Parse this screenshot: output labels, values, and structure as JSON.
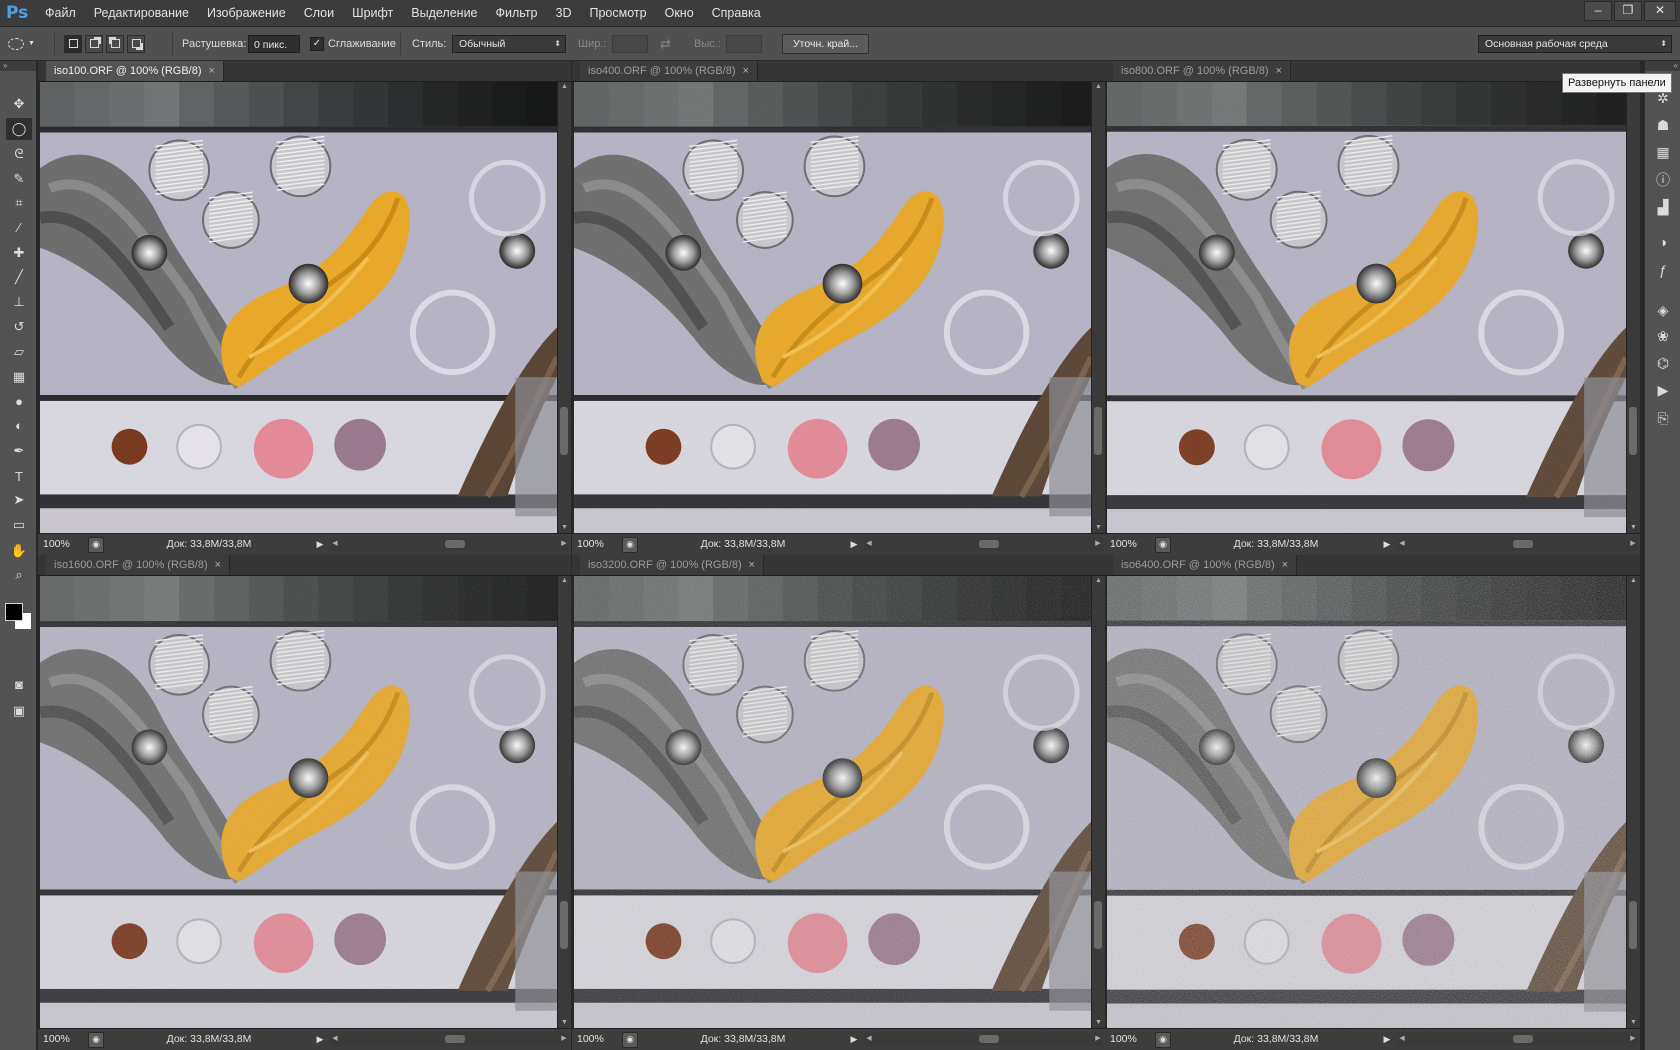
{
  "app": {
    "logo": "Ps"
  },
  "menu": [
    "Файл",
    "Редактирование",
    "Изображение",
    "Слои",
    "Шрифт",
    "Выделение",
    "Фильтр",
    "3D",
    "Просмотр",
    "Окно",
    "Справка"
  ],
  "window_controls": {
    "minimize": "–",
    "restore": "❐",
    "close": "✕"
  },
  "options": {
    "feather_label": "Растушевка:",
    "feather_value": "0 пикс.",
    "antialias_label": "Сглаживание",
    "antialias_checked": true,
    "antialias_mark": "✓",
    "style_label": "Стиль:",
    "style_value": "Обычный",
    "width_label": "Шир.:",
    "height_label": "Выс.:",
    "refine_button": "Уточн. край...",
    "workspace_value": "Основная рабочая среда"
  },
  "tooltip": "Развернуть панели",
  "documents": [
    {
      "tab": "iso100.ORF @ 100% (RGB/8)",
      "close": "×",
      "zoom": "100%",
      "doc_info": "Док: 33,8M/33,8M",
      "active": true,
      "noise_level": 0.0
    },
    {
      "tab": "iso400.ORF @ 100% (RGB/8)",
      "close": "×",
      "zoom": "100%",
      "doc_info": "Док: 33,8M/33,8M",
      "active": false,
      "noise_level": 0.1
    },
    {
      "tab": "iso800.ORF @ 100% (RGB/8)",
      "close": "×",
      "zoom": "100%",
      "doc_info": "Док: 33,8M/33,8M",
      "active": false,
      "noise_level": 0.2
    },
    {
      "tab": "iso1600.ORF @ 100% (RGB/8)",
      "close": "×",
      "zoom": "100%",
      "doc_info": "Док: 33,8M/33,8M",
      "active": false,
      "noise_level": 0.35
    },
    {
      "tab": "iso3200.ORF @ 100% (RGB/8)",
      "close": "×",
      "zoom": "100%",
      "doc_info": "Док: 33,8M/33,8M",
      "active": false,
      "noise_level": 0.6
    },
    {
      "tab": "iso6400.ORF @ 100% (RGB/8)",
      "close": "×",
      "zoom": "100%",
      "doc_info": "Док: 33,8M/33,8M",
      "active": false,
      "noise_level": 0.9
    }
  ],
  "icons": {
    "tools": [
      "move-icon",
      "elliptical-marquee-icon",
      "lasso-icon",
      "quick-selection-icon",
      "crop-icon",
      "eyedropper-icon",
      "spot-healing-icon",
      "brush-icon",
      "clone-stamp-icon",
      "history-brush-icon",
      "eraser-icon",
      "gradient-icon",
      "blur-icon",
      "dodge-icon",
      "pen-icon",
      "type-icon",
      "path-selection-icon",
      "rectangle-shape-icon",
      "hand-icon",
      "zoom-icon",
      "quick-mask-icon",
      "screen-mode-icon"
    ],
    "panels": [
      "settings-icon",
      "3d-icon",
      "grid-icon",
      "info-icon",
      "histogram-icon",
      "adjustments-icon",
      "styles-icon",
      "layers-icon",
      "channels-icon",
      "paths-icon",
      "actions-icon",
      "history-icon"
    ]
  },
  "colors": {
    "foreground": "#000000",
    "background": "#ffffff",
    "accent": "#4aa0e6",
    "thread_yellow": "#e8a82a",
    "board_lavender": "#b4b2c0"
  }
}
